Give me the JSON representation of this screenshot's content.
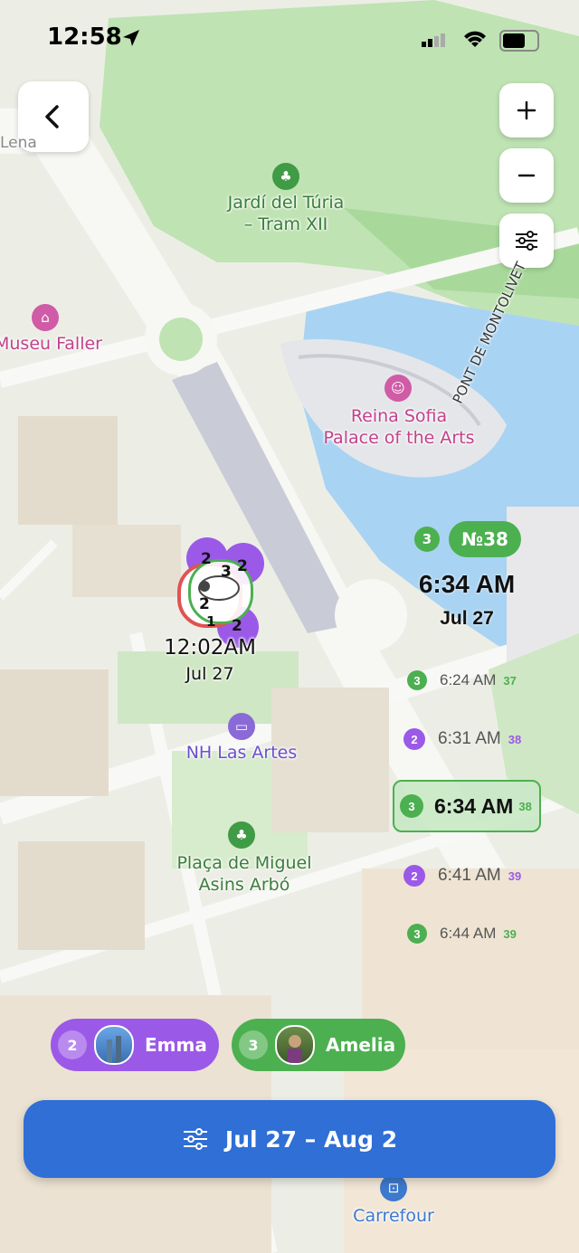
{
  "status_bar": {
    "time": "12:58"
  },
  "map_labels": {
    "park": "Jardí del Túria\n– Tram XII",
    "museum": "Museu Faller",
    "museum_partial": "Lena",
    "palace": "Reina Sofia\nPalace of the Arts",
    "road": "PONT DE MONTOLIVET",
    "hotel": "NH Las Artes",
    "square": "Plaça de Miguel\nAsins Arbó",
    "store": "Carrefour"
  },
  "cluster": {
    "time": "12:02AM",
    "date": "Jul 27",
    "counts": [
      "2",
      "2",
      "3",
      "2",
      "1",
      "2"
    ]
  },
  "current": {
    "badge": "3",
    "stop": "№38",
    "time": "6:34 AM",
    "date": "Jul 27"
  },
  "timeline": [
    {
      "badge": "3",
      "time": "6:24 AM",
      "num": "37",
      "color": "#4caf50"
    },
    {
      "badge": "2",
      "time": "6:31 AM",
      "num": "38",
      "color": "#9b59e8"
    },
    {
      "badge": "3",
      "time": "6:34 AM",
      "num": "38",
      "color": "#4caf50"
    },
    {
      "badge": "2",
      "time": "6:41 AM",
      "num": "39",
      "color": "#9b59e8"
    },
    {
      "badge": "3",
      "time": "6:44 AM",
      "num": "39",
      "color": "#4caf50"
    }
  ],
  "people": [
    {
      "count": "2",
      "name": "Emma",
      "color": "#9b59e8"
    },
    {
      "count": "3",
      "name": "Amelia",
      "color": "#4cb050"
    }
  ],
  "filter_button": {
    "label": "Jul 27 – Aug 2"
  },
  "colors": {
    "primary": "#2f6fd6",
    "purple": "#9b59e8",
    "green": "#4cb050"
  }
}
